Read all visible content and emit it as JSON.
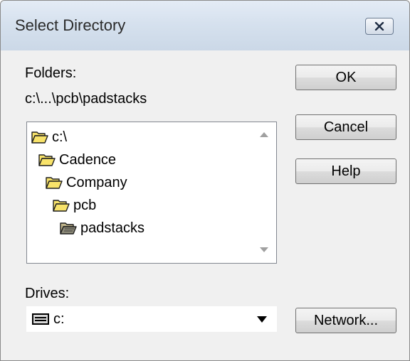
{
  "window": {
    "title": "Select Directory",
    "close_icon": "close-x-icon"
  },
  "folders": {
    "label": "Folders:",
    "current_path": "c:\\...\\pcb\\padstacks",
    "items": [
      {
        "label": "c:\\",
        "icon": "open-folder-icon",
        "level": 0
      },
      {
        "label": "Cadence",
        "icon": "open-folder-icon",
        "level": 1
      },
      {
        "label": "Company",
        "icon": "open-folder-icon",
        "level": 2
      },
      {
        "label": "pcb",
        "icon": "open-folder-icon",
        "level": 3
      },
      {
        "label": "padstacks",
        "icon": "open-folder-selected-icon",
        "level": 4
      }
    ]
  },
  "drives": {
    "label": "Drives:",
    "selected": "c:",
    "icon": "hard-drive-icon"
  },
  "buttons": {
    "ok": "OK",
    "cancel": "Cancel",
    "help": "Help",
    "network": "Network..."
  },
  "colors": {
    "folder_fill": "#f8e36a",
    "folder_outline": "#1e1e1e",
    "selected_folder_fill": "#bfb48a"
  }
}
